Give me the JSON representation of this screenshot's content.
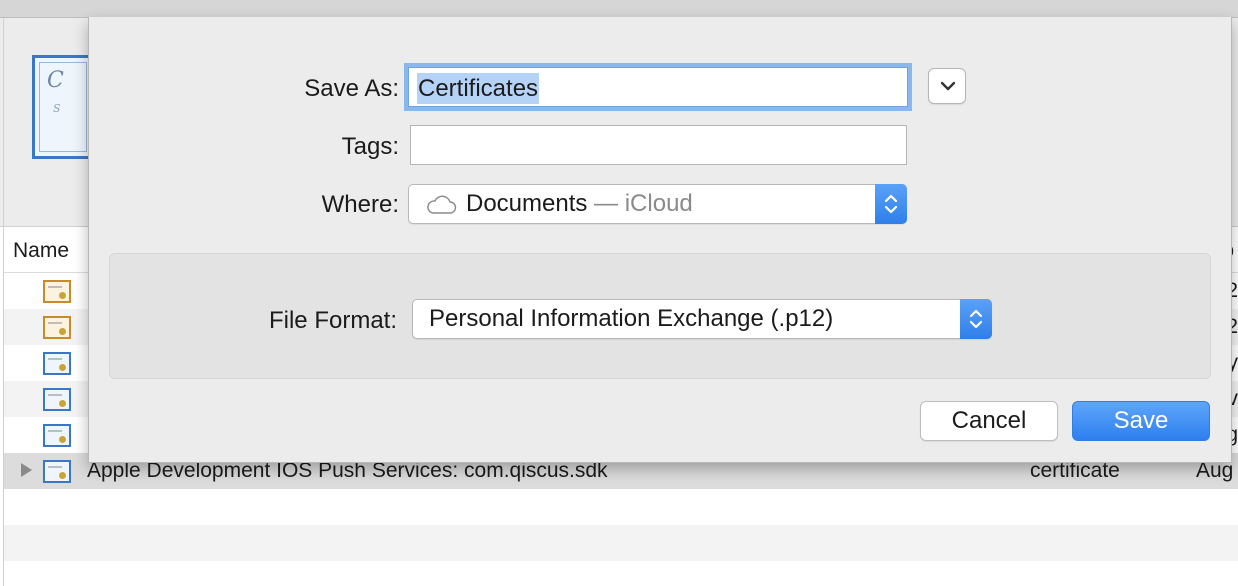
{
  "background": {
    "column_header": {
      "name": "Name",
      "right_clip": "o"
    },
    "rows": [
      {
        "icon": "certificate-gold-icon",
        "name": "",
        "kind": "",
        "date": "",
        "clip": "2"
      },
      {
        "icon": "certificate-gold-icon",
        "name": "",
        "kind": "",
        "date": "",
        "clip": "2"
      },
      {
        "icon": "certificate-blue-icon",
        "name": "",
        "kind": "",
        "date": "",
        "clip": "y"
      },
      {
        "icon": "certificate-blue-icon",
        "name": "",
        "kind": "",
        "date": "",
        "clip": "v"
      },
      {
        "icon": "certificate-blue-icon",
        "name": "",
        "kind": "",
        "date": "",
        "clip": "g"
      },
      {
        "icon": "certificate-blue-icon",
        "name": "Apple Development IOS Push Services: com.qiscus.sdk",
        "kind": "certificate",
        "date": "Aug",
        "clip": ""
      }
    ]
  },
  "dialog": {
    "save_as_label": "Save As:",
    "save_as_value": "Certificates",
    "tags_label": "Tags:",
    "tags_value": "",
    "where_label": "Where:",
    "where_primary": "Documents",
    "where_secondary": " — iCloud",
    "file_format_label": "File Format:",
    "file_format_value": "Personal Information Exchange (.p12)",
    "cancel_label": "Cancel",
    "save_label": "Save"
  },
  "colors": {
    "accent": "#2f7fe9",
    "focus_ring": "#8ab7ec",
    "selection": "#b5d3f6"
  }
}
